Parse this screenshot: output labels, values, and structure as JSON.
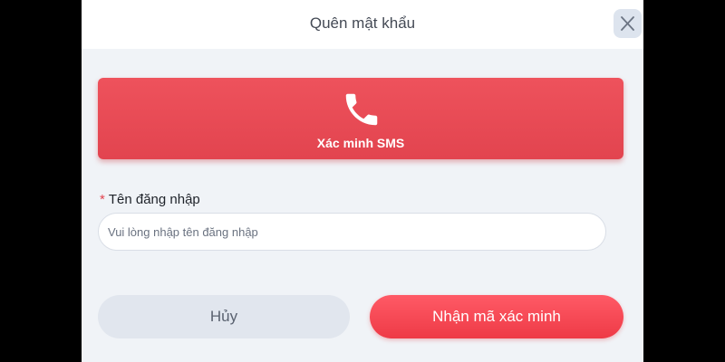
{
  "modal": {
    "title": "Quên mật khẩu",
    "close_icon": "close-icon"
  },
  "sms_option": {
    "icon": "phone-icon",
    "label": "Xác minh SMS",
    "color": "#e84a55"
  },
  "username_field": {
    "required_mark": "*",
    "label": "Tên đăng nhập",
    "placeholder": "Vui lòng nhập tên đăng nhập",
    "value": ""
  },
  "actions": {
    "cancel_label": "Hủy",
    "confirm_label": "Nhận mã xác minh",
    "confirm_color": "#f5404c"
  }
}
